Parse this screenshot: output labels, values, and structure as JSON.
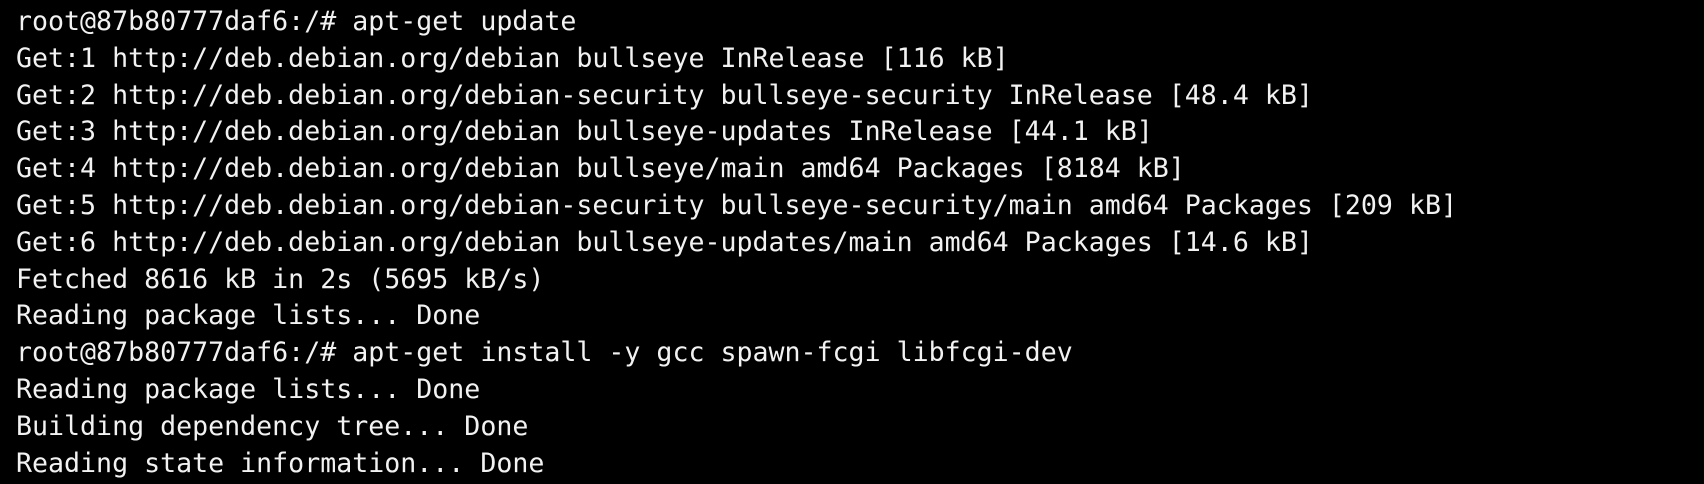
{
  "terminal": {
    "colors": {
      "background": "#000000",
      "foreground": "#f2f2f2"
    },
    "lines": [
      "root@87b80777daf6:/# apt-get update",
      "Get:1 http://deb.debian.org/debian bullseye InRelease [116 kB]",
      "Get:2 http://deb.debian.org/debian-security bullseye-security InRelease [48.4 kB]",
      "Get:3 http://deb.debian.org/debian bullseye-updates InRelease [44.1 kB]",
      "Get:4 http://deb.debian.org/debian bullseye/main amd64 Packages [8184 kB]",
      "Get:5 http://deb.debian.org/debian-security bullseye-security/main amd64 Packages [209 kB]",
      "Get:6 http://deb.debian.org/debian bullseye-updates/main amd64 Packages [14.6 kB]",
      "Fetched 8616 kB in 2s (5695 kB/s)",
      "Reading package lists... Done",
      "root@87b80777daf6:/# apt-get install -y gcc spawn-fcgi libfcgi-dev",
      "Reading package lists... Done",
      "Building dependency tree... Done",
      "Reading state information... Done"
    ]
  }
}
